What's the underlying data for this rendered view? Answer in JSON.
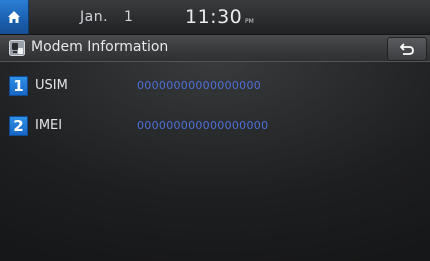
{
  "status_bar": {
    "date_month": "Jan.",
    "date_day": "1",
    "time": "11:30",
    "ampm": "PM",
    "home_icon": "home-icon"
  },
  "title_bar": {
    "icon": "modem-info-icon",
    "title": "Modem Information",
    "back_icon": "back-arrow-icon"
  },
  "info": {
    "rows": [
      {
        "number": "1",
        "label": "USIM",
        "value": "00000000000000000"
      },
      {
        "number": "2",
        "label": "IMEI",
        "value": "000000000000000000"
      }
    ]
  },
  "colors": {
    "accent": "#1a6ccc",
    "value_text": "#4d6fd8",
    "background": "#1d1e20"
  }
}
